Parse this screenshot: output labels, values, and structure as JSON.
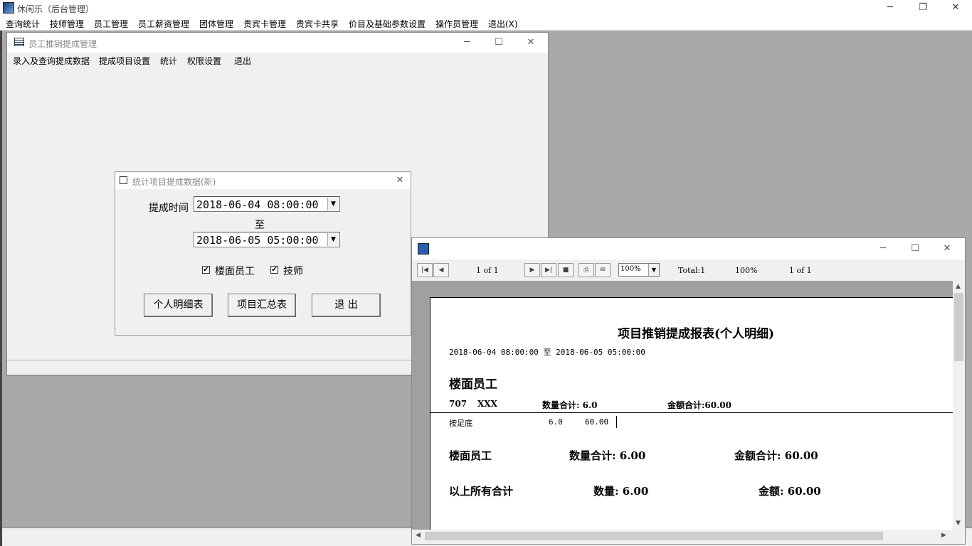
{
  "app": {
    "title": "休闲乐（后台管理）",
    "menu": [
      "查询统计",
      "技师管理",
      "员工管理",
      "员工薪资管理",
      "团体管理",
      "贵宾卡管理",
      "贵宾卡共享",
      "价目及基础参数设置",
      "操作员管理",
      "退出(X)"
    ]
  },
  "employee_window": {
    "title": "员工推销提成管理",
    "menu": [
      "录入及查询提成数据",
      "提成项目设置",
      "统计",
      "权限设置",
      "退出"
    ]
  },
  "stats_dialog": {
    "title": "统计项目提成数据(新)",
    "time_label": "提成时间",
    "start_time": "2018-06-04 08:00:00",
    "to_label": "至",
    "end_time": "2018-06-05 05:00:00",
    "checkbox_floor": {
      "label": "楼面员工",
      "checked": true
    },
    "checkbox_tech": {
      "label": "技师",
      "checked": true
    },
    "buttons": {
      "personal": "个人明细表",
      "summary": "项目汇总表",
      "exit": "退 出"
    }
  },
  "report_viewer": {
    "page_indicator": "1 of 1",
    "zoom": "100%",
    "total": "Total:1",
    "percent": "100%",
    "page_count": "1 of 1",
    "report": {
      "title": "项目推销提成报表(个人明细)",
      "range": "2018-06-04 08:00:00 至 2018-06-05 05:00:00",
      "group": "楼面员工",
      "emp_id": "707",
      "emp_name": "XXX",
      "qty_label": "数量合计: 6.0",
      "amt_label": "金额合计:60.00",
      "item_name": "按足底",
      "item_qty": "6.0",
      "item_amt": "60.00",
      "group_total_name": "楼面员工",
      "group_total_qty": "数量合计: 6.00",
      "group_total_amt": "金额合计: 60.00",
      "grand_label": "以上所有合计",
      "grand_qty": "数量: 6.00",
      "grand_amt": "金额: 60.00"
    }
  }
}
